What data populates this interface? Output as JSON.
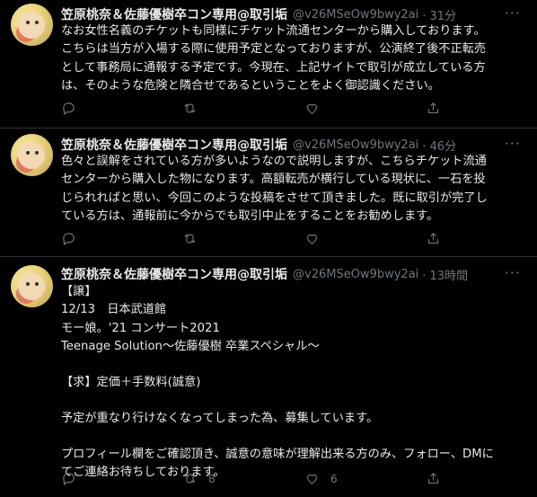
{
  "tweets": [
    {
      "name": "笠原桃奈＆佐藤優樹卒コン専用@取引垢",
      "handle": "@v26MSeOw9bwy2ai",
      "time": "· 31分",
      "more": "···",
      "lines": [
        "なお女性名義のチケットも同様にチケット流通センターから購入しております。",
        "こちらは当方が入場する際に使用予定となっておりますが、公演終了後不正転売",
        "として事務局に通報する予定です。今現在、上記サイトで取引が成立している方",
        "は、そのような危険と隣合せであるということをよく御認識ください。"
      ],
      "retweets": "",
      "likes": ""
    },
    {
      "name": "笠原桃奈＆佐藤優樹卒コン専用@取引垢",
      "handle": "@v26MSeOw9bwy2ai",
      "time": "· 46分",
      "more": "···",
      "lines": [
        "色々と誤解をされている方が多いようなので説明しますが、こちらチケット流通",
        "センターから購入した物になります。高額転売が横行している現状に、一石を投",
        "じられればと思い、今回このような投稿をさせて頂きました。既に取引が完了し",
        "ている方は、通報前に今からでも取引中止をすることをお勧めします。"
      ],
      "retweets": "",
      "likes": ""
    },
    {
      "name": "笠原桃奈＆佐藤優樹卒コン専用@取引垢",
      "handle": "@v26MSeOw9bwy2ai",
      "time": "· 13時間",
      "more": "···",
      "lines": [
        "【譲】",
        "12/13　日本武道館",
        "モー娘。'21 コンサート2021",
        "Teenage Solution～佐藤優樹 卒業スペシャル～",
        "",
        "【求】定価＋手数料(誠意)",
        "",
        "予定が重なり行けなくなってしまった為、募集しています。",
        "",
        "プロフィール欄をご確認頂き、誠意の意味が理解出来る方のみ、フォロー、DMに",
        "てご連絡お待ちしております。"
      ],
      "retweets": "8",
      "likes": "6"
    }
  ]
}
